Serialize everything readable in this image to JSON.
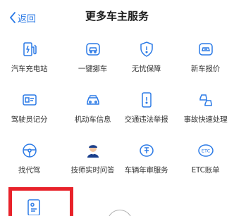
{
  "header": {
    "back_label": "返回",
    "title": "更多车主服务"
  },
  "services": [
    {
      "label": "汽车充电站",
      "icon": "ev-charger-icon"
    },
    {
      "label": "一键挪车",
      "icon": "car-move-icon"
    },
    {
      "label": "无忧保障",
      "icon": "shield-icon"
    },
    {
      "label": "新车报价",
      "icon": "new-car-price-icon"
    },
    {
      "label": "驾驶员记分",
      "icon": "license-card-icon"
    },
    {
      "label": "机动车信息",
      "icon": "vehicle-info-icon"
    },
    {
      "label": "交通违法举报",
      "icon": "report-phone-icon"
    },
    {
      "label": "事故快速处理",
      "icon": "accident-cars-icon"
    },
    {
      "label": "找代驾",
      "icon": "steering-wheel-icon"
    },
    {
      "label": "技师实时问答",
      "icon": "technician-icon"
    },
    {
      "label": "车辆年审服务",
      "icon": "annual-inspection-icon"
    },
    {
      "label": "ETC账单",
      "icon": "etc-icon"
    }
  ],
  "colors": {
    "accent": "#2b7ae6",
    "highlight": "#e8222a",
    "label": "#333333"
  }
}
